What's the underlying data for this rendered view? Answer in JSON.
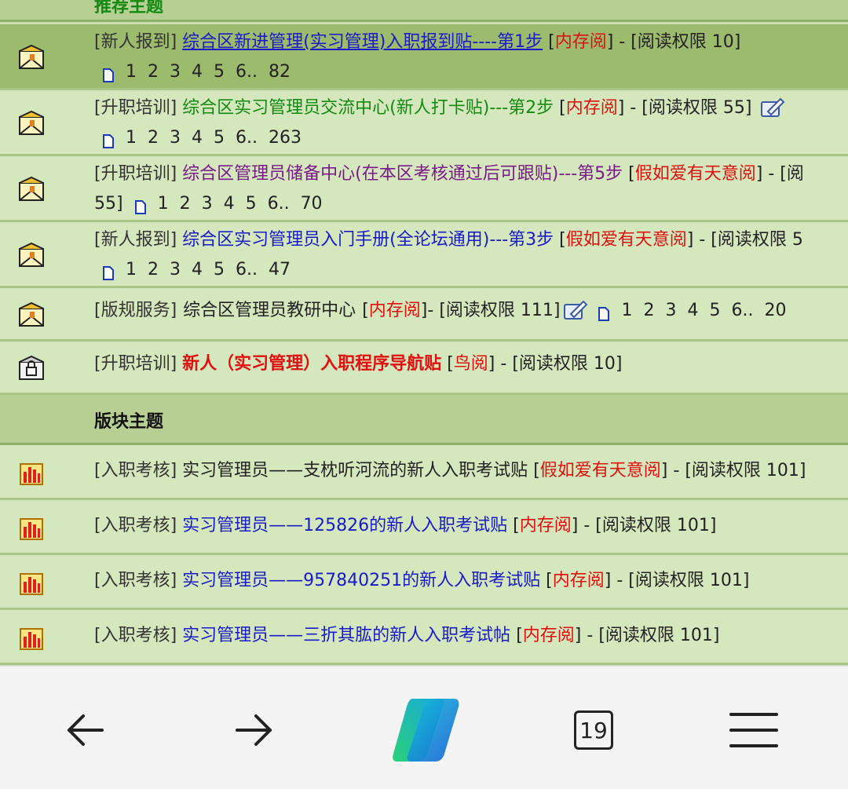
{
  "sections": {
    "recommended_header": "推荐主题",
    "board_header": "版块主题"
  },
  "recommended": [
    {
      "tag": "[新人报到]",
      "title": "综合区新进管理(实习管理)入职报到贴----第1步",
      "read_open": "[",
      "read_level": "内存阅",
      "read_close": "]",
      "perm": " - [阅读权限 10]",
      "pages": [
        "1",
        "2",
        "3",
        "4",
        "5",
        "6..",
        "82"
      ]
    },
    {
      "tag": "[升职培训]",
      "title": "综合区实习管理员交流中心(新人打卡贴)---第2步",
      "read_open": "[",
      "read_level": "内存阅",
      "read_close": "]",
      "perm": " - [阅读权限 55]",
      "pages": [
        "1",
        "2",
        "3",
        "4",
        "5",
        "6..",
        "263"
      ]
    },
    {
      "tag": "[升职培训]",
      "title": "综合区管理员储备中心(在本区考核通过后可跟贴)---第5步",
      "read_open": "[",
      "read_level": "假如爱有天意阅",
      "read_close": "]",
      "perm": " - [阅",
      "perm_cont": "55]",
      "pages": [
        "1",
        "2",
        "3",
        "4",
        "5",
        "6..",
        "70"
      ]
    },
    {
      "tag": "[新人报到]",
      "title": "综合区实习管理员入门手册(全论坛通用)---第3步",
      "read_open": "[",
      "read_level": "假如爱有天意阅",
      "read_close": "]",
      "perm": " - [阅读权限 5",
      "pages": [
        "1",
        "2",
        "3",
        "4",
        "5",
        "6..",
        "47"
      ]
    },
    {
      "tag": "[版规服务]",
      "title": "综合区管理员教研中心",
      "read_open": "[",
      "read_level": "内存阅",
      "read_close": "]",
      "perm": " - [阅读权限 111]",
      "pages": [
        "1",
        "2",
        "3",
        "4",
        "5",
        "6..",
        "20"
      ]
    },
    {
      "tag": "[升职培训]",
      "title": "新人（实习管理）入职程序导航贴",
      "read_open": "[",
      "read_level": "鸟阅",
      "read_close": "]",
      "perm": " - [阅读权限 10]"
    }
  ],
  "board": [
    {
      "tag": "[入职考核]",
      "title": "实习管理员——支枕听河流的新人入职考试贴",
      "read_open": "[",
      "read_level": "假如爱有天意阅",
      "read_close": "]",
      "perm": " - [阅读权限 101]"
    },
    {
      "tag": "[入职考核]",
      "title": "实习管理员——125826的新人入职考试贴",
      "read_open": "[",
      "read_level": "内存阅",
      "read_close": "]",
      "perm": " - [阅读权限 101]"
    },
    {
      "tag": "[入职考核]",
      "title": "实习管理员——957840251的新人入职考试贴",
      "read_open": "[",
      "read_level": "内存阅",
      "read_close": "]",
      "perm": " - [阅读权限 101]"
    },
    {
      "tag": "[入职考核]",
      "title": "实习管理员——三折其肱的新人入职考试帖",
      "read_open": "[",
      "read_level": "内存阅",
      "read_close": "]",
      "perm": " - [阅读权限 101]"
    }
  ],
  "browser": {
    "tab_count": "19",
    "icons": [
      "back-arrow-icon",
      "forward-arrow-icon",
      "copilot-icon",
      "tab-count-icon",
      "menu-icon"
    ]
  },
  "colors": {
    "row_bg": "#d5e8bd",
    "highlight_bg": "#9cbb6d",
    "header_bg": "#b8cf94",
    "link_blue": "#1a1ac8",
    "green": "#128a12",
    "purple": "#7a1a8a",
    "red": "#e01010"
  }
}
